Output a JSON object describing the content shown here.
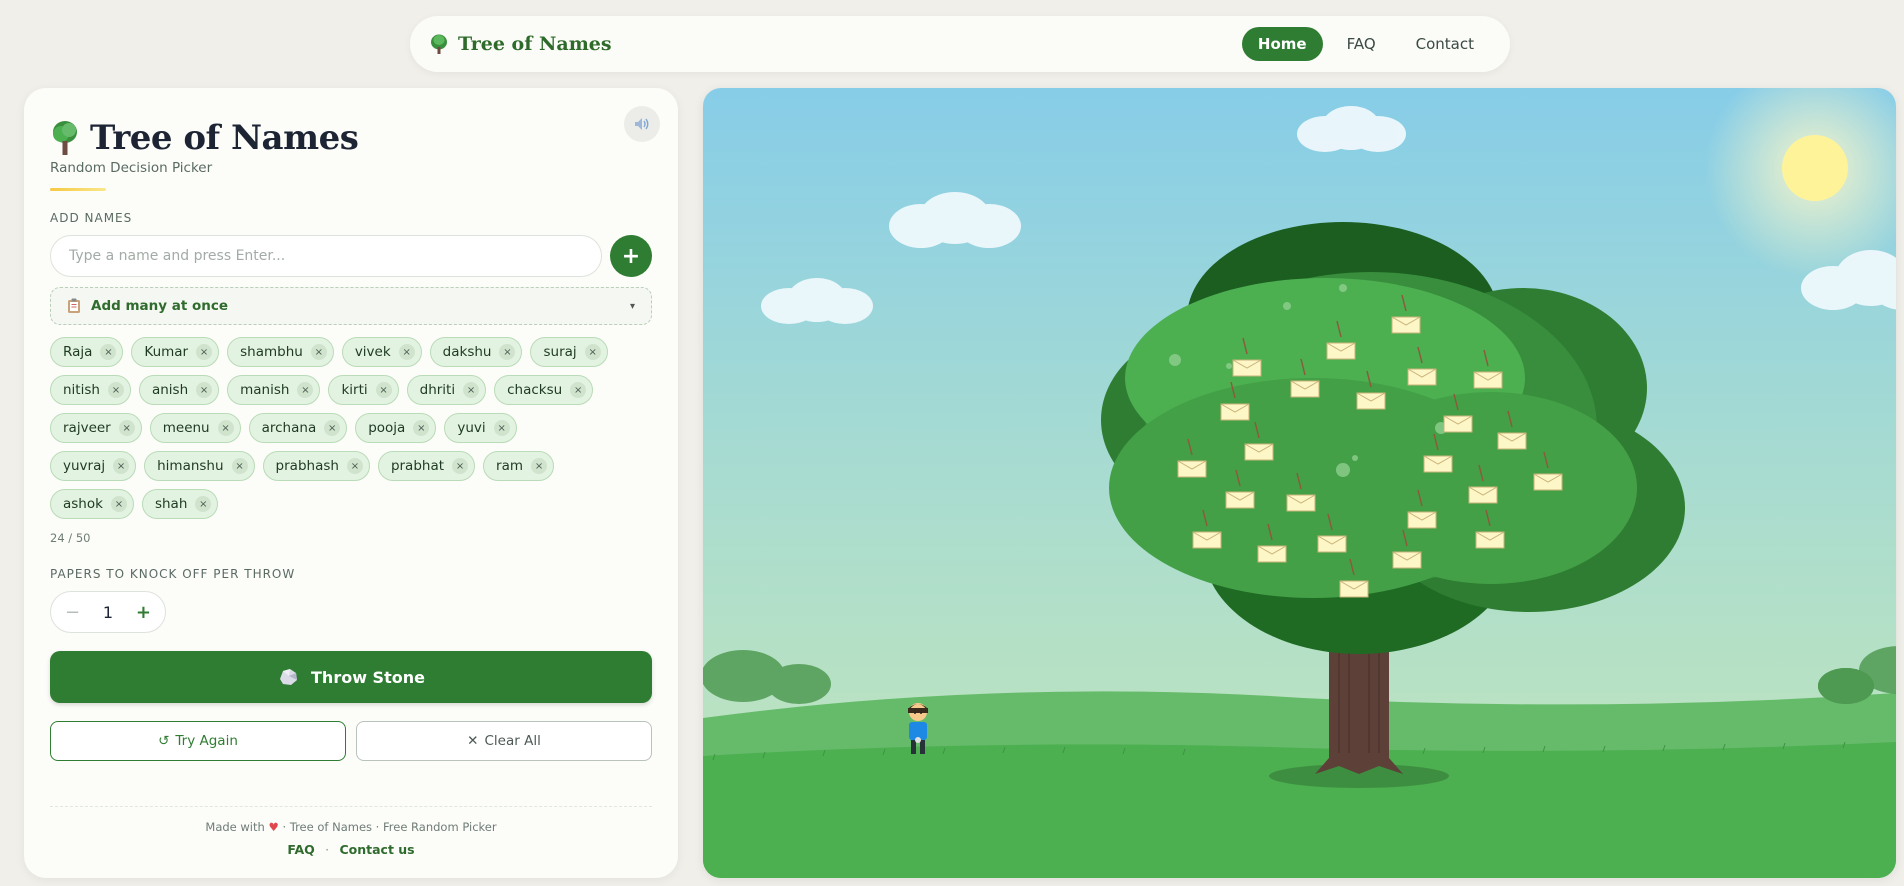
{
  "nav": {
    "brand": "Tree of Names",
    "links": [
      {
        "label": "Home",
        "active": true
      },
      {
        "label": "FAQ",
        "active": false
      },
      {
        "label": "Contact",
        "active": false
      }
    ]
  },
  "panel": {
    "title": "Tree of Names",
    "subtitle": "Random Decision Picker",
    "add_names_label": "ADD NAMES",
    "input_placeholder": "Type a name and press Enter...",
    "add_icon": "+",
    "bulk_label": "Add many at once",
    "names": [
      "Raja",
      "Kumar",
      "shambhu",
      "vivek",
      "dakshu",
      "suraj",
      "nitish",
      "anish",
      "manish",
      "kirti",
      "dhriti",
      "chacksu",
      "rajveer",
      "meenu",
      "archana",
      "pooja",
      "yuvi",
      "yuvraj",
      "himanshu",
      "prabhash",
      "prabhat",
      "ram",
      "ashok",
      "shah"
    ],
    "chip_remove": "×",
    "count": "24 / 50",
    "papers_label": "PAPERS TO KNOCK OFF PER THROW",
    "papers_value": "1",
    "stepper_minus": "−",
    "stepper_plus": "+",
    "throw_label": "Throw Stone",
    "try_again_label": "Try Again",
    "clear_all_label": "Clear All",
    "footer_made": "Made with",
    "footer_heart": "♥",
    "footer_rest": "· Tree of Names · Free Random Picker",
    "footer_faq": "FAQ",
    "footer_sep": "·",
    "footer_contact": "Contact us"
  },
  "colors": {
    "accent": "#2f7d32",
    "chip_bg": "#e3f3e1",
    "sky_top": "#87cfe8",
    "grass": "#4caf50"
  }
}
